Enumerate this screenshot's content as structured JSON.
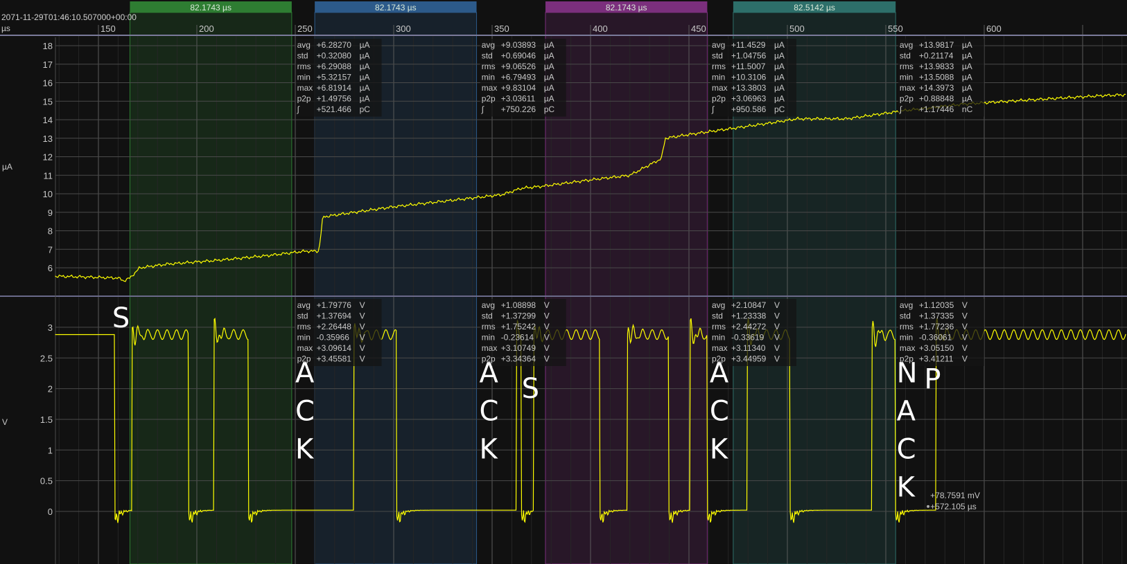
{
  "timestamp": "2071-11-29T01:46:10.507000+00:00",
  "x_unit": "µs",
  "current_unit": "µA",
  "voltage_unit": "V",
  "colors": {
    "trace": "#ffff00",
    "green": "#2e7d32",
    "blue": "#2c5a8a",
    "purple": "#7b2f7d",
    "teal": "#2d6f6a"
  },
  "chart_data": {
    "type": "line",
    "x_ticks": [
      "150",
      "200",
      "250",
      "300",
      "350",
      "400",
      "450",
      "500",
      "550",
      "600"
    ],
    "x_tick_values": [
      150,
      200,
      250,
      300,
      350,
      400,
      450,
      500,
      550,
      600
    ],
    "xlim": [
      128.2,
      672.5
    ],
    "current": {
      "ylabel": "µA",
      "ylim": [
        5,
        18.4
      ],
      "y_ticks": [
        "6",
        "7",
        "8",
        "9",
        "10",
        "11",
        "12",
        "13",
        "14",
        "15",
        "16",
        "17",
        "18"
      ],
      "points": [
        [
          128,
          5.55
        ],
        [
          145,
          5.5
        ],
        [
          160,
          5.45
        ],
        [
          163,
          5.3
        ],
        [
          166,
          5.45
        ],
        [
          171,
          6.0
        ],
        [
          185,
          6.2
        ],
        [
          210,
          6.4
        ],
        [
          235,
          6.65
        ],
        [
          255,
          6.9
        ],
        [
          262,
          6.9
        ],
        [
          263,
          7.8
        ],
        [
          264,
          8.75
        ],
        [
          280,
          9.0
        ],
        [
          300,
          9.3
        ],
        [
          330,
          9.65
        ],
        [
          355,
          9.95
        ],
        [
          365,
          10.3
        ],
        [
          375,
          10.4
        ],
        [
          400,
          10.75
        ],
        [
          420,
          11.0
        ],
        [
          436,
          11.9
        ],
        [
          438,
          13.0
        ],
        [
          450,
          13.2
        ],
        [
          470,
          13.5
        ],
        [
          490,
          13.8
        ],
        [
          505,
          14.05
        ],
        [
          530,
          14.05
        ],
        [
          560,
          14.5
        ],
        [
          590,
          14.85
        ],
        [
          620,
          15.05
        ],
        [
          660,
          15.3
        ],
        [
          672,
          15.35
        ]
      ]
    },
    "voltage": {
      "ylabel": "V",
      "ylim": [
        -0.3,
        3.4
      ],
      "y_ticks": [
        "0",
        "0.5",
        "1",
        "1.5",
        "2",
        "2.5",
        "3"
      ],
      "transitions": [
        [
          128,
          1
        ],
        [
          158.1,
          0
        ],
        [
          166.9,
          1
        ],
        [
          195.8,
          0
        ],
        [
          208.5,
          1
        ],
        [
          226.1,
          0
        ],
        [
          279.6,
          1
        ],
        [
          301.4,
          0
        ],
        [
          362.3,
          1
        ],
        [
          364.8,
          0
        ],
        [
          371.1,
          1
        ],
        [
          404.6,
          0
        ],
        [
          418.7,
          1
        ],
        [
          439.8,
          0
        ],
        [
          450.4,
          1
        ],
        [
          459.2,
          0
        ],
        [
          479.6,
          1
        ],
        [
          501.4,
          0
        ],
        [
          543.0,
          1
        ],
        [
          554.9,
          0
        ],
        [
          575.4,
          1
        ]
      ]
    }
  },
  "cursors": [
    {
      "label": "82.1743 µs",
      "start": 166,
      "end": 248.2,
      "color": "#2e7d32",
      "fill": "rgba(46,125,50,0.22)"
    },
    {
      "label": "82.1743 µs",
      "start": 259.9,
      "end": 342.1,
      "color": "#2c5a8a",
      "fill": "rgba(44,90,138,0.22)"
    },
    {
      "label": "82.1743 µs",
      "start": 377.1,
      "end": 459.3,
      "color": "#7b2f7d",
      "fill": "rgba(123,47,125,0.22)"
    },
    {
      "label": "82.5142 µs",
      "start": 472.5,
      "end": 555,
      "color": "#2d6f6a",
      "fill": "rgba(45,111,106,0.22)"
    }
  ],
  "current_stats": [
    {
      "at": 249.5,
      "rows": [
        [
          "avg",
          "+6.28270",
          "µA"
        ],
        [
          "std",
          "+0.32080",
          "µA"
        ],
        [
          "rms",
          "+6.29088",
          "µA"
        ],
        [
          "min",
          "+5.32157",
          "µA"
        ],
        [
          "max",
          "+6.81914",
          "µA"
        ],
        [
          "p2p",
          "+1.49756",
          "µA"
        ],
        [
          "∫",
          "+521.466",
          "pC"
        ]
      ]
    },
    {
      "at": 343.2,
      "rows": [
        [
          "avg",
          "+9.03893",
          "µA"
        ],
        [
          "std",
          "+0.69046",
          "µA"
        ],
        [
          "rms",
          "+9.06526",
          "µA"
        ],
        [
          "min",
          "+6.79493",
          "µA"
        ],
        [
          "max",
          "+9.83104",
          "µA"
        ],
        [
          "p2p",
          "+3.03611",
          "µA"
        ],
        [
          "∫",
          "+750.226",
          "pC"
        ]
      ]
    },
    {
      "at": 460.2,
      "rows": [
        [
          "avg",
          "+11.4529",
          "µA"
        ],
        [
          "std",
          "+1.04756",
          "µA"
        ],
        [
          "rms",
          "+11.5007",
          "µA"
        ],
        [
          "min",
          "+10.3106",
          "µA"
        ],
        [
          "max",
          "+13.3803",
          "µA"
        ],
        [
          "p2p",
          "+3.06963",
          "µA"
        ],
        [
          "∫",
          "+950.586",
          "pC"
        ]
      ]
    },
    {
      "at": 555.6,
      "rows": [
        [
          "avg",
          "+13.9817",
          "µA"
        ],
        [
          "std",
          "+0.21174",
          "µA"
        ],
        [
          "rms",
          "+13.9833",
          "µA"
        ],
        [
          "min",
          "+13.5088",
          "µA"
        ],
        [
          "max",
          "+14.3973",
          "µA"
        ],
        [
          "p2p",
          "+0.88848",
          "µA"
        ],
        [
          "∫",
          "+1.17446",
          "nC"
        ]
      ]
    }
  ],
  "voltage_stats": [
    {
      "at": 249.5,
      "rows": [
        [
          "avg",
          "+1.79776",
          "V"
        ],
        [
          "std",
          "+1.37694",
          "V"
        ],
        [
          "rms",
          "+2.26448",
          "V"
        ],
        [
          "min",
          "-0.35966",
          "V"
        ],
        [
          "max",
          "+3.09614",
          "V"
        ],
        [
          "p2p",
          "+3.45581",
          "V"
        ]
      ]
    },
    {
      "at": 343.2,
      "rows": [
        [
          "avg",
          "+1.08898",
          "V"
        ],
        [
          "std",
          "+1.37299",
          "V"
        ],
        [
          "rms",
          "+1.75242",
          "V"
        ],
        [
          "min",
          "-0.23614",
          "V"
        ],
        [
          "max",
          "+3.10749",
          "V"
        ],
        [
          "p2p",
          "+3.34364",
          "V"
        ]
      ]
    },
    {
      "at": 460.2,
      "rows": [
        [
          "avg",
          "+2.10847",
          "V"
        ],
        [
          "std",
          "+1.23338",
          "V"
        ],
        [
          "rms",
          "+2.44272",
          "V"
        ],
        [
          "min",
          "-0.33619",
          "V"
        ],
        [
          "max",
          "+3.11340",
          "V"
        ],
        [
          "p2p",
          "+3.44959",
          "V"
        ]
      ]
    },
    {
      "at": 555.6,
      "rows": [
        [
          "avg",
          "+1.12035",
          "V"
        ],
        [
          "std",
          "+1.37335",
          "V"
        ],
        [
          "rms",
          "+1.77236",
          "V"
        ],
        [
          "min",
          "-0.36061",
          "V"
        ],
        [
          "max",
          "+3.05150",
          "V"
        ],
        [
          "p2p",
          "+3.41211",
          "V"
        ]
      ]
    }
  ],
  "annotations": [
    {
      "text": "S",
      "t": 157,
      "v": 3.0
    },
    {
      "text": "A\nC\nK",
      "t": 250,
      "v": 2.1
    },
    {
      "text": "A\nC\nK",
      "t": 343.5,
      "v": 2.1
    },
    {
      "text": "S",
      "t": 365,
      "v": 1.85
    },
    {
      "text": "A\nC\nK",
      "t": 460.5,
      "v": 2.1
    },
    {
      "text": "N\nA\nC\nK",
      "t": 555.5,
      "v": 2.1
    },
    {
      "text": "P",
      "t": 569.5,
      "v": 2.0
    }
  ],
  "cursor_readout": {
    "value": "+78.7591 mV",
    "time": "+572.105 µs"
  }
}
